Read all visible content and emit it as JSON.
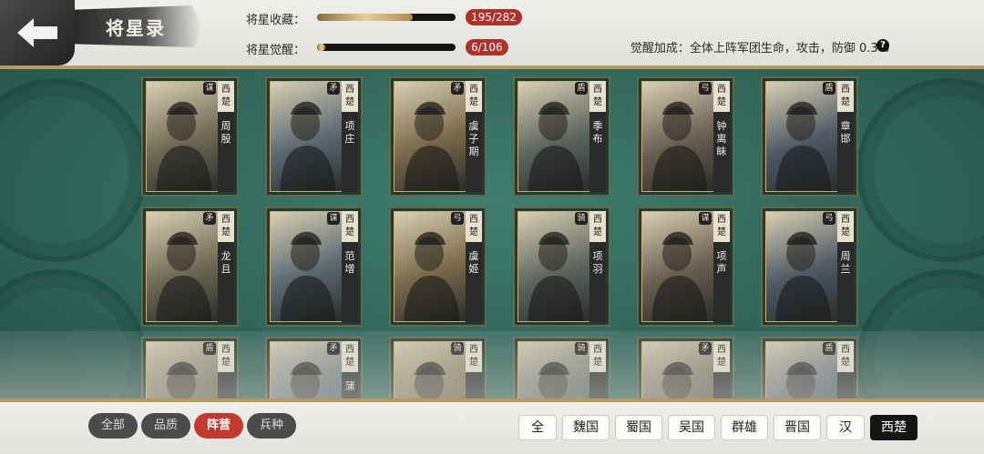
{
  "header": {
    "title": "将星录",
    "collection_label": "将星收藏：",
    "collection_value": "195/282",
    "collection_progress": 0.69,
    "awaken_label": "将星觉醒：",
    "awaken_value": "6/106",
    "awaken_progress": 0.06,
    "bonus_text": "觉醒加成：全体上阵军团生命，攻击，防御 0.3%"
  },
  "icons": {
    "back": "back-arrow-icon",
    "help": "question-icon"
  },
  "colors": {
    "accent_red": "#c23a2e",
    "panel_green": "#3f7e6f",
    "gold": "#b89a5c"
  },
  "cards": [
    {
      "cls": "谋",
      "faction": "西楚",
      "name": "周殷"
    },
    {
      "cls": "矛",
      "faction": "西楚",
      "name": "项庄"
    },
    {
      "cls": "矛",
      "faction": "西楚",
      "name": "虞子期"
    },
    {
      "cls": "盾",
      "faction": "西楚",
      "name": "季布"
    },
    {
      "cls": "弓",
      "faction": "西楚",
      "name": "钟离眛"
    },
    {
      "cls": "盾",
      "faction": "西楚",
      "name": "章邯"
    },
    {
      "cls": "矛",
      "faction": "西楚",
      "name": "龙且"
    },
    {
      "cls": "谋",
      "faction": "西楚",
      "name": "范增"
    },
    {
      "cls": "弓",
      "faction": "西楚",
      "name": "虞姬"
    },
    {
      "cls": "骑",
      "faction": "西楚",
      "name": "项羽"
    },
    {
      "cls": "谋",
      "faction": "西楚",
      "name": "项声"
    },
    {
      "cls": "弓",
      "faction": "西楚",
      "name": "周兰"
    },
    {
      "cls": "盾",
      "faction": "西楚",
      "name": ""
    },
    {
      "cls": "矛",
      "faction": "西楚",
      "name": "蒲"
    },
    {
      "cls": "骑",
      "faction": "西楚",
      "name": ""
    },
    {
      "cls": "骑",
      "faction": "西楚",
      "name": ""
    },
    {
      "cls": "矛",
      "faction": "西楚",
      "name": ""
    },
    {
      "cls": "盾",
      "faction": "西楚",
      "name": ""
    }
  ],
  "filters": {
    "sort_tabs": [
      "全部",
      "品质",
      "阵营",
      "兵种"
    ],
    "sort_active": 2,
    "factions": [
      "全",
      "魏国",
      "蜀国",
      "吴国",
      "群雄",
      "晋国",
      "汉",
      "西楚"
    ],
    "faction_active": 7
  }
}
